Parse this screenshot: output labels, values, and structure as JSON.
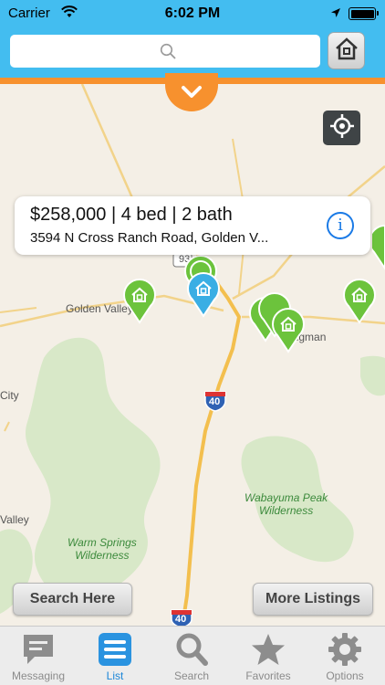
{
  "status_bar": {
    "carrier": "Carrier",
    "time": "6:02 PM"
  },
  "header": {
    "search": {
      "value": "",
      "placeholder": ""
    }
  },
  "map": {
    "labels": {
      "golden_valley": "Golden Valley",
      "kingman": "Kingman",
      "city": "City",
      "valley": "Valley",
      "wabayuma_peak": "Wabayuma Peak\nWilderness",
      "warm_springs": "Warm Springs\nWilderness",
      "route_93": "93",
      "i40": "40"
    },
    "callout": {
      "price_line": "$258,000 | 4 bed | 2 bath",
      "address": "3594 N Cross Ranch Road, Golden V...",
      "info_glyph": "i"
    },
    "buttons": {
      "search_here": "Search Here",
      "more_listings": "More Listings"
    }
  },
  "tab_bar": {
    "tabs": [
      {
        "label": "Messaging",
        "icon": "message-icon"
      },
      {
        "label": "List",
        "icon": "list-icon",
        "active": true
      },
      {
        "label": "Search",
        "icon": "search-icon"
      },
      {
        "label": "Favorites",
        "icon": "star-icon"
      },
      {
        "label": "Options",
        "icon": "gear-icon"
      }
    ]
  },
  "colors": {
    "header_blue": "#43bdf0",
    "accent_orange": "#f7912e",
    "pin_green": "#6cc33c",
    "pin_blue": "#3aaee4",
    "active_tab": "#1b86d8"
  }
}
